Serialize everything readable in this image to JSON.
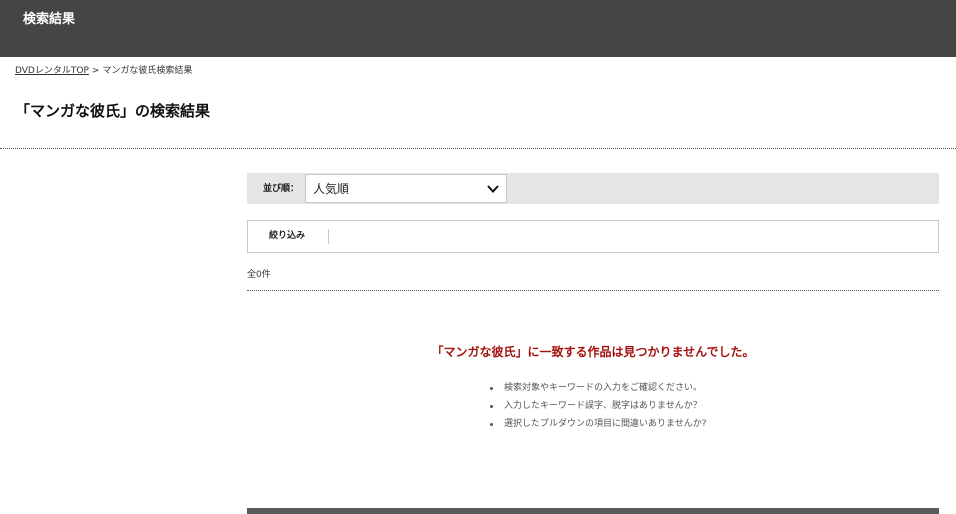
{
  "header": {
    "title": "検索結果"
  },
  "breadcrumb": {
    "home_label": "DVDレンタルTOP",
    "separator": ">",
    "current": "マンガな彼氏検索結果"
  },
  "page_title": "「マンガな彼氏」の検索結果",
  "sort": {
    "label": "並び順：",
    "selected": "人気順"
  },
  "filter": {
    "label": "絞り込み"
  },
  "result_count": "全0件",
  "no_result": {
    "message": "「マンガな彼氏」に一致する作品は見つかりませんでした。",
    "hints": [
      "検索対象やキーワードの入力をご確認ください。",
      "入力したキーワード誤字、脱字はありませんか？",
      "選択したプルダウンの項目に間違いありませんか?"
    ]
  },
  "colors": {
    "header_bg": "#454545",
    "error_text": "#a3130f",
    "sort_bar_bg": "#e5e5e5"
  },
  "icons": {
    "select_chevron": "chevron-down-icon"
  }
}
